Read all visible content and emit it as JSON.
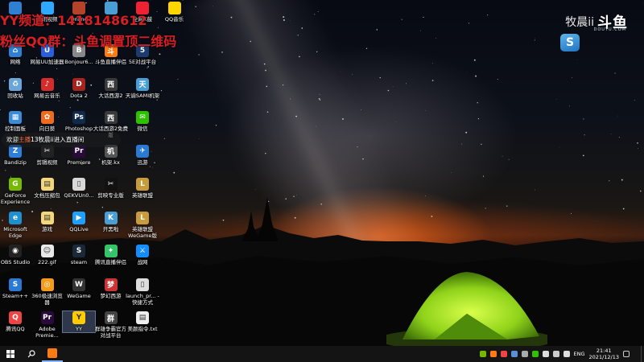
{
  "overlay": {
    "line1": "YY频道：1418148612",
    "line2": "粉丝QQ群：斗鱼调置顶二维码",
    "chat_prefix": "欢迎",
    "chat_highlight": "主播",
    "chat_middle": "13",
    "chat_suffix": "牧晨ii进入直播间"
  },
  "watermark": {
    "name": "牧晨ii",
    "logo": "斗鱼",
    "sub": "DOUYU.COM"
  },
  "side_app": {
    "glyph": "S"
  },
  "icons": [
    {
      "id": "network",
      "label": "网络",
      "color": "#2f7fd3",
      "glyph": "⌂",
      "col": 0,
      "row": 0
    },
    {
      "id": "netease-uu",
      "label": "网易UU加速器",
      "color": "#2b5fd9",
      "glyph": "U",
      "col": 1,
      "row": 0
    },
    {
      "id": "bonjour",
      "label": "Bonjour6...",
      "color": "#888",
      "glyph": "B",
      "col": 2,
      "row": 0
    },
    {
      "id": "douyu-assist",
      "label": "斗鱼直播伴侣",
      "color": "#ff7a10",
      "glyph": "斗",
      "col": 3,
      "row": 0
    },
    {
      "id": "5e",
      "label": "5E对战平台",
      "color": "#1d3c6e",
      "glyph": "5",
      "col": 4,
      "row": 0
    },
    {
      "id": "recycle",
      "label": "回收站",
      "color": "#6aa6d8",
      "glyph": "♻",
      "col": 0,
      "row": 1
    },
    {
      "id": "netease-music",
      "label": "网易云音乐",
      "color": "#d62b2b",
      "glyph": "♪",
      "col": 1,
      "row": 1
    },
    {
      "id": "dota2",
      "label": "Dota 2",
      "color": "#a6231e",
      "glyph": "D",
      "col": 2,
      "row": 1
    },
    {
      "id": "dahua2",
      "label": "大话西游2",
      "color": "#3a3a3a",
      "glyph": "西",
      "col": 3,
      "row": 1
    },
    {
      "id": "tianyu",
      "label": "天谕SAMI机架",
      "color": "#4a9ed6",
      "glyph": "天",
      "col": 4,
      "row": 1
    },
    {
      "id": "control-panel",
      "label": "控制面板",
      "color": "#3b8bd6",
      "glyph": "▦",
      "col": 0,
      "row": 2
    },
    {
      "id": "xiangrikui",
      "label": "向日葵",
      "color": "#ef6c1f",
      "glyph": "✿",
      "col": 1,
      "row": 2
    },
    {
      "id": "photoshop",
      "label": "Photoshop",
      "color": "#0f2a4a",
      "glyph": "Ps",
      "col": 2,
      "row": 2
    },
    {
      "id": "dahua2-free",
      "label": "大话西游2免费版",
      "color": "#3a3a3a",
      "glyph": "西",
      "col": 3,
      "row": 2
    },
    {
      "id": "wechat",
      "label": "微信",
      "color": "#2dc100",
      "glyph": "✉",
      "col": 4,
      "row": 2
    },
    {
      "id": "bandizip",
      "label": "Bandizip",
      "color": "#2e7fd8",
      "glyph": "Z",
      "col": 0,
      "row": 3
    },
    {
      "id": "jianying",
      "label": "剪辑视频",
      "color": "#222",
      "glyph": "✂",
      "col": 1,
      "row": 3
    },
    {
      "id": "premiere",
      "label": "Premiere",
      "color": "#2a0a3a",
      "glyph": "Pr",
      "col": 2,
      "row": 3
    },
    {
      "id": "jiji",
      "label": "机架.kx",
      "color": "#555",
      "glyph": "机",
      "col": 3,
      "row": 3
    },
    {
      "id": "xunyou",
      "label": "迅游",
      "color": "#2a7ad4",
      "glyph": "✈",
      "col": 4,
      "row": 3
    },
    {
      "id": "geforce",
      "label": "GeForce Experience",
      "color": "#76b900",
      "glyph": "G",
      "col": 0,
      "row": 4
    },
    {
      "id": "text-doc",
      "label": "文档压缩包",
      "color": "#f3d77a",
      "glyph": "▤",
      "col": 1,
      "row": 4
    },
    {
      "id": "qekv",
      "label": "QEKVUn0...",
      "color": "#d8d8d8",
      "glyph": "▯",
      "col": 2,
      "row": 4
    },
    {
      "id": "pro-tool",
      "label": "剪映专业版",
      "color": "#111",
      "glyph": "✂",
      "col": 3,
      "row": 4
    },
    {
      "id": "lol",
      "label": "英雄联盟",
      "color": "#c89b3c",
      "glyph": "L",
      "col": 4,
      "row": 4
    },
    {
      "id": "edge",
      "label": "Microsoft Edge",
      "color": "#1e8fd0",
      "glyph": "e",
      "col": 0,
      "row": 5
    },
    {
      "id": "games",
      "label": "游戏",
      "color": "#f3d77a",
      "glyph": "▤",
      "col": 1,
      "row": 5
    },
    {
      "id": "qqlive",
      "label": "QQLive",
      "color": "#1fa0ff",
      "glyph": "▶",
      "col": 2,
      "row": 5
    },
    {
      "id": "kaihei",
      "label": "开黑啦",
      "color": "#4a9ed6",
      "glyph": "K",
      "col": 3,
      "row": 5
    },
    {
      "id": "wegame-lol",
      "label": "英雄联盟WeGame版",
      "color": "#c89b3c",
      "glyph": "L",
      "col": 4,
      "row": 5
    },
    {
      "id": "obs",
      "label": "OBS Studio",
      "color": "#222",
      "glyph": "◉",
      "col": 0,
      "row": 6
    },
    {
      "id": "gif",
      "label": "222.gif",
      "color": "#e9e9e9",
      "glyph": "☺",
      "col": 1,
      "row": 6
    },
    {
      "id": "steam",
      "label": "steam",
      "color": "#1b2838",
      "glyph": "S",
      "col": 2,
      "row": 6
    },
    {
      "id": "tencent-live",
      "label": "腾讯直播伴侣",
      "color": "#35c46a",
      "glyph": "✦",
      "col": 3,
      "row": 6
    },
    {
      "id": "zhanwang",
      "label": "战网",
      "color": "#148eff",
      "glyph": "⚔",
      "col": 4,
      "row": 6
    },
    {
      "id": "steampp",
      "label": "Steam++",
      "color": "#2a7ad4",
      "glyph": "S",
      "col": 0,
      "row": 7
    },
    {
      "id": "360",
      "label": "360极速浏览器",
      "color": "#f59b1c",
      "glyph": "◎",
      "col": 1,
      "row": 7
    },
    {
      "id": "wegame",
      "label": "WeGame",
      "color": "#333",
      "glyph": "W",
      "col": 2,
      "row": 7
    },
    {
      "id": "menghuan",
      "label": "梦幻西游",
      "color": "#c33",
      "glyph": "梦",
      "col": 3,
      "row": 7
    },
    {
      "id": "launch",
      "label": "launch_pr... - 快捷方式",
      "color": "#ddd",
      "glyph": "▯",
      "col": 4,
      "row": 7
    },
    {
      "id": "tencent-qq",
      "label": "腾讯QQ",
      "color": "#e44",
      "glyph": "Q",
      "col": 0,
      "row": 8
    },
    {
      "id": "adobe-prem",
      "label": "Adobe Premie...",
      "color": "#2a0a3a",
      "glyph": "Pr",
      "col": 1,
      "row": 8
    },
    {
      "id": "yy",
      "label": "YY",
      "color": "#ffcc00",
      "glyph": "Y",
      "col": 2,
      "row": 8,
      "selected": true
    },
    {
      "id": "qunxiong",
      "label": "群雄争霸官方对战平台",
      "color": "#444",
      "glyph": "群",
      "col": 3,
      "row": 8
    },
    {
      "id": "beauty-txt",
      "label": "美颜指令.txt",
      "color": "#eee",
      "glyph": "▤",
      "col": 4,
      "row": 8
    }
  ],
  "top_partial_icons": [
    {
      "id": "partial-1",
      "label": "",
      "color": "#2f7fd3",
      "col": 0
    },
    {
      "id": "partial-2",
      "label": "腾讯视频",
      "color": "#2fa8ff",
      "col": 1
    },
    {
      "id": "partial-3",
      "label": "Online",
      "color": "#b4432a",
      "col": 2
    },
    {
      "id": "partial-4",
      "label": "",
      "color": "#4a9ed6",
      "col": 3
    },
    {
      "id": "partial-5",
      "label": "全网X鼓",
      "color": "#e23",
      "col": 4
    },
    {
      "id": "partial-6",
      "label": "QQ音乐",
      "color": "#ffd500",
      "col": 5
    }
  ],
  "taskbar": {
    "tray_text": "ENG",
    "time": "21:41",
    "date": "2021/12/13"
  }
}
